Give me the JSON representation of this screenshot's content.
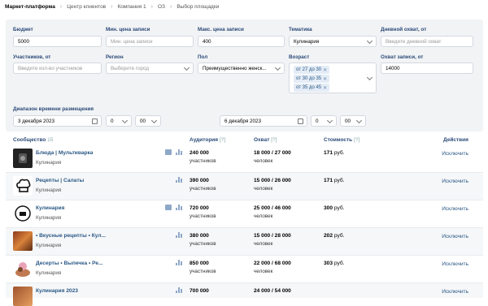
{
  "breadcrumb": [
    "Маркет-платформа",
    "Центр клиентов",
    "Компания 1",
    "ОЗ",
    "Выбор площадки"
  ],
  "filters": {
    "budget": {
      "label": "Бюджет",
      "value": "5000"
    },
    "min_price": {
      "label": "Мин. цена записи",
      "placeholder": "Мин. цена записи"
    },
    "max_price": {
      "label": "Макс. цена записи",
      "value": "400"
    },
    "topic": {
      "label": "Тематика",
      "value": "Кулинария"
    },
    "daily_reach": {
      "label": "Дневной охват, от",
      "placeholder": "Введите дневной охват"
    },
    "members": {
      "label": "Участников, от",
      "placeholder": "Введите кол-во участников"
    },
    "region": {
      "label": "Регион",
      "placeholder": "Выберите город"
    },
    "gender": {
      "label": "Пол",
      "value": "Преимущественно женск..."
    },
    "age": {
      "label": "Возраст",
      "tags": [
        "от 27 до 30",
        "от 30 до 35",
        "от 35 до 45"
      ]
    },
    "post_reach": {
      "label": "Охват записи, от",
      "value": "14000"
    },
    "time_range": {
      "label": "Диапазон времени размещения",
      "start_date": "3 декабря 2023",
      "start_hour": "0",
      "start_min": "00",
      "end_date": "6 декабря 2023",
      "end_hour": "0",
      "end_min": "00"
    }
  },
  "table": {
    "headers": {
      "community": "Сообщество",
      "community_count": "15",
      "audience": "Аудитория",
      "reach": "Охват",
      "cost": "Стоимость",
      "actions": "Действия",
      "hint": "[?]"
    },
    "rows": [
      {
        "name": "Блюда | Мультиварка",
        "topic": "Кулинария",
        "audience": "240 000",
        "audience_unit": "участников",
        "reach": "18 000 / 27 000",
        "reach_unit": "человек",
        "cost": "171",
        "cost_unit": "руб.",
        "action": "Исключить",
        "thumb": "dark-logo"
      },
      {
        "name": "Рецепты | Салаты",
        "topic": "Кулинария",
        "audience": "390 000",
        "audience_unit": "участников",
        "reach": "15 000 / 26 000",
        "reach_unit": "человек",
        "cost": "171",
        "cost_unit": "руб.",
        "action": "Исключить",
        "thumb": "chef-hat-logo"
      },
      {
        "name": "Кулинария",
        "topic": "Кулинария",
        "audience": "720 000",
        "audience_unit": "участников",
        "reach": "25 000 / 46 000",
        "reach_unit": "человек",
        "cost": "300",
        "cost_unit": "руб.",
        "action": "Исключить",
        "thumb": "chef-logo"
      },
      {
        "name": "• Вкусные рецепты • Кул...",
        "topic": "Кулинария",
        "audience": "380 000",
        "audience_unit": "участников",
        "reach": "15 000 / 28 000",
        "reach_unit": "человек",
        "cost": "202",
        "cost_unit": "руб.",
        "action": "Исключить",
        "thumb": "food-photo"
      },
      {
        "name": "Десерты • Выпечка • Ре...",
        "topic": "Кулинария",
        "audience": "850 000",
        "audience_unit": "участников",
        "reach": "22 000 / 68 000",
        "reach_unit": "человек",
        "cost": "303",
        "cost_unit": "руб.",
        "action": "Исключить",
        "thumb": "dessert-photo"
      },
      {
        "name": "Кулинария 2023",
        "topic": "Кулинария",
        "audience": "700 000",
        "audience_unit": "участников",
        "reach": "24 000 / 54 000",
        "reach_unit": "человек",
        "cost": "",
        "cost_unit": "",
        "action": "Исключить",
        "thumb": "food-photo-2"
      }
    ]
  }
}
